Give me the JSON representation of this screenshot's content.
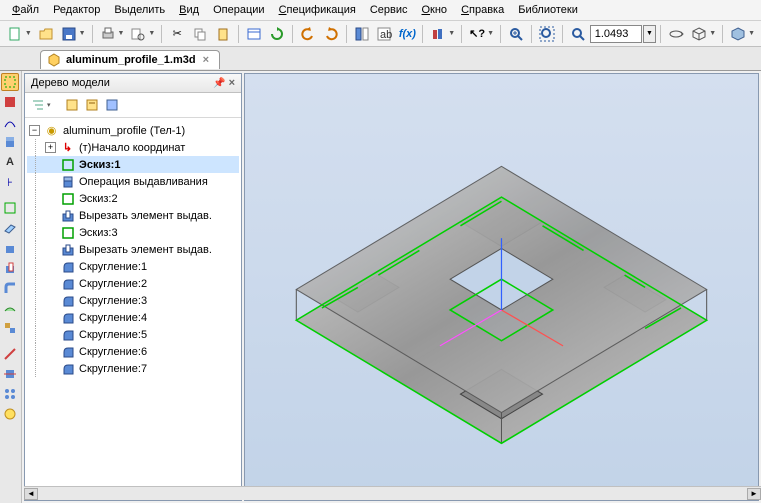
{
  "menu": {
    "file": "Файл",
    "edit": "Редактор",
    "select": "Выделить",
    "view": "Вид",
    "operations": "Операции",
    "spec": "Спецификация",
    "service": "Сервис",
    "window": "Окно",
    "help": "Справка",
    "libs": "Библиотеки"
  },
  "toolbar": {
    "zoom_value": "1.0493"
  },
  "tab": {
    "title": "aluminum_profile_1.m3d"
  },
  "tree": {
    "header": "Дерево модели",
    "root": "aluminum_profile (Тел-1)",
    "items": [
      {
        "icon": "origin",
        "label": "(т)Начало координат",
        "expand": "+"
      },
      {
        "icon": "sketch",
        "label": "Эскиз:1",
        "selected": true
      },
      {
        "icon": "extrude",
        "label": "Операция выдавливания"
      },
      {
        "icon": "sketch",
        "label": "Эскиз:2"
      },
      {
        "icon": "cut",
        "label": "Вырезать элемент выдав."
      },
      {
        "icon": "sketch",
        "label": "Эскиз:3"
      },
      {
        "icon": "cut",
        "label": "Вырезать элемент выдав."
      },
      {
        "icon": "fillet",
        "label": "Скругление:1"
      },
      {
        "icon": "fillet",
        "label": "Скругление:2"
      },
      {
        "icon": "fillet",
        "label": "Скругление:3"
      },
      {
        "icon": "fillet",
        "label": "Скругление:4"
      },
      {
        "icon": "fillet",
        "label": "Скругление:5"
      },
      {
        "icon": "fillet",
        "label": "Скругление:6"
      },
      {
        "icon": "fillet",
        "label": "Скругление:7"
      }
    ]
  }
}
